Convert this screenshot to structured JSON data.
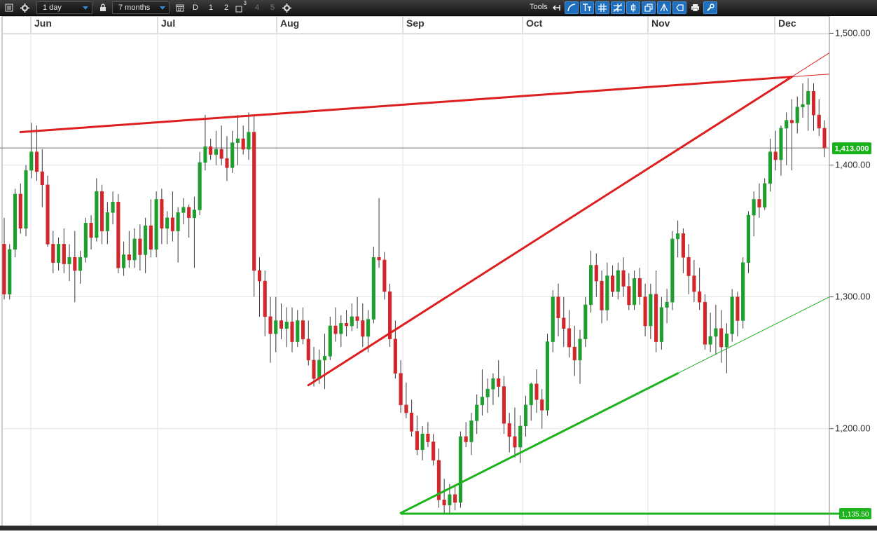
{
  "toolbar": {
    "interval": "1 day",
    "range": "7 months",
    "buttons": [
      "D",
      "1",
      "2",
      "4",
      "5"
    ],
    "layout_badge": "3",
    "tools_label": "Tools"
  },
  "chart_data": {
    "type": "candlestick",
    "x_labels": [
      "Jun",
      "Jul",
      "Aug",
      "Sep",
      "Oct",
      "Nov",
      "Dec"
    ],
    "y_ticks": [
      "1,500.00",
      "1,400.00",
      "1,300.00",
      "1,200.00"
    ],
    "ylim": [
      1120,
      1500
    ],
    "current_price": 1413.0,
    "current_price_label": "1,413.000",
    "horizontal_line": 1135.5,
    "horizontal_line_label": "1,135.50",
    "up_color": "#1e9e2e",
    "down_color": "#d3262a",
    "trendlines": [
      {
        "color": "#dd1f1f",
        "from": {
          "i": 3,
          "v": 1425
        },
        "to": {
          "i": 145,
          "v": 1467
        }
      },
      {
        "color": "#dd1f1f",
        "from": {
          "i": 56,
          "v": 1233
        },
        "to": {
          "i": 145,
          "v": 1467
        }
      },
      {
        "color": "#1db31d",
        "from": {
          "i": 73,
          "v": 1136
        },
        "to": {
          "i": 124,
          "v": 1242
        }
      }
    ],
    "candles": [
      [
        1340,
        1360,
        1298,
        1302
      ],
      [
        1302,
        1340,
        1298,
        1336
      ],
      [
        1336,
        1382,
        1330,
        1378
      ],
      [
        1378,
        1386,
        1348,
        1352
      ],
      [
        1352,
        1400,
        1346,
        1396
      ],
      [
        1396,
        1432,
        1390,
        1410
      ],
      [
        1410,
        1430,
        1388,
        1395
      ],
      [
        1395,
        1412,
        1368,
        1385
      ],
      [
        1385,
        1392,
        1338,
        1340
      ],
      [
        1340,
        1350,
        1318,
        1326
      ],
      [
        1326,
        1345,
        1320,
        1340
      ],
      [
        1340,
        1352,
        1318,
        1325
      ],
      [
        1325,
        1340,
        1312,
        1330
      ],
      [
        1330,
        1350,
        1296,
        1320
      ],
      [
        1320,
        1335,
        1310,
        1330
      ],
      [
        1330,
        1360,
        1326,
        1356
      ],
      [
        1356,
        1362,
        1336,
        1345
      ],
      [
        1345,
        1390,
        1342,
        1380
      ],
      [
        1380,
        1385,
        1340,
        1350
      ],
      [
        1350,
        1372,
        1340,
        1364
      ],
      [
        1364,
        1380,
        1355,
        1372
      ],
      [
        1372,
        1378,
        1318,
        1322
      ],
      [
        1322,
        1342,
        1316,
        1332
      ],
      [
        1332,
        1350,
        1322,
        1328
      ],
      [
        1328,
        1352,
        1322,
        1344
      ],
      [
        1344,
        1355,
        1320,
        1332
      ],
      [
        1332,
        1360,
        1318,
        1354
      ],
      [
        1354,
        1374,
        1330,
        1336
      ],
      [
        1336,
        1380,
        1330,
        1374
      ],
      [
        1374,
        1382,
        1340,
        1352
      ],
      [
        1352,
        1365,
        1340,
        1360
      ],
      [
        1360,
        1380,
        1342,
        1350
      ],
      [
        1350,
        1368,
        1326,
        1364
      ],
      [
        1364,
        1375,
        1355,
        1368
      ],
      [
        1368,
        1370,
        1345,
        1360
      ],
      [
        1360,
        1376,
        1322,
        1366
      ],
      [
        1366,
        1410,
        1362,
        1402
      ],
      [
        1402,
        1438,
        1396,
        1414
      ],
      [
        1414,
        1420,
        1404,
        1408
      ],
      [
        1408,
        1426,
        1400,
        1412
      ],
      [
        1412,
        1430,
        1400,
        1405
      ],
      [
        1405,
        1422,
        1388,
        1398
      ],
      [
        1398,
        1426,
        1394,
        1417
      ],
      [
        1417,
        1438,
        1400,
        1420
      ],
      [
        1420,
        1430,
        1408,
        1412
      ],
      [
        1412,
        1440,
        1404,
        1425
      ],
      [
        1425,
        1438,
        1300,
        1320
      ],
      [
        1320,
        1330,
        1285,
        1312
      ],
      [
        1312,
        1320,
        1270,
        1285
      ],
      [
        1285,
        1300,
        1250,
        1272
      ],
      [
        1272,
        1300,
        1258,
        1282
      ],
      [
        1282,
        1295,
        1268,
        1276
      ],
      [
        1276,
        1292,
        1262,
        1281
      ],
      [
        1281,
        1292,
        1258,
        1266
      ],
      [
        1266,
        1290,
        1262,
        1282
      ],
      [
        1282,
        1292,
        1264,
        1268
      ],
      [
        1268,
        1282,
        1248,
        1252
      ],
      [
        1252,
        1262,
        1232,
        1238
      ],
      [
        1238,
        1260,
        1234,
        1252
      ],
      [
        1252,
        1272,
        1230,
        1255
      ],
      [
        1255,
        1285,
        1252,
        1278
      ],
      [
        1278,
        1292,
        1266,
        1272
      ],
      [
        1272,
        1286,
        1262,
        1280
      ],
      [
        1280,
        1290,
        1270,
        1278
      ],
      [
        1278,
        1295,
        1274,
        1285
      ],
      [
        1285,
        1300,
        1276,
        1282
      ],
      [
        1282,
        1295,
        1262,
        1270
      ],
      [
        1270,
        1290,
        1258,
        1283
      ],
      [
        1283,
        1338,
        1280,
        1330
      ],
      [
        1330,
        1375,
        1322,
        1328
      ],
      [
        1328,
        1334,
        1298,
        1304
      ],
      [
        1304,
        1310,
        1262,
        1268
      ],
      [
        1268,
        1282,
        1238,
        1242
      ],
      [
        1242,
        1252,
        1212,
        1218
      ],
      [
        1218,
        1235,
        1208,
        1212
      ],
      [
        1212,
        1222,
        1194,
        1198
      ],
      [
        1198,
        1210,
        1180,
        1184
      ],
      [
        1184,
        1202,
        1176,
        1196
      ],
      [
        1196,
        1205,
        1186,
        1190
      ],
      [
        1190,
        1196,
        1172,
        1176
      ],
      [
        1176,
        1185,
        1140,
        1146
      ],
      [
        1146,
        1162,
        1136,
        1142
      ],
      [
        1142,
        1158,
        1136,
        1150
      ],
      [
        1150,
        1156,
        1138,
        1144
      ],
      [
        1144,
        1198,
        1140,
        1194
      ],
      [
        1194,
        1205,
        1186,
        1190
      ],
      [
        1190,
        1212,
        1180,
        1206
      ],
      [
        1206,
        1226,
        1196,
        1218
      ],
      [
        1218,
        1245,
        1210,
        1224
      ],
      [
        1224,
        1238,
        1212,
        1230
      ],
      [
        1230,
        1242,
        1218,
        1238
      ],
      [
        1238,
        1252,
        1224,
        1232
      ],
      [
        1232,
        1240,
        1196,
        1204
      ],
      [
        1204,
        1212,
        1182,
        1194
      ],
      [
        1194,
        1216,
        1178,
        1186
      ],
      [
        1186,
        1210,
        1174,
        1202
      ],
      [
        1202,
        1225,
        1194,
        1218
      ],
      [
        1218,
        1235,
        1206,
        1234
      ],
      [
        1234,
        1245,
        1212,
        1222
      ],
      [
        1222,
        1230,
        1200,
        1214
      ],
      [
        1214,
        1272,
        1210,
        1266
      ],
      [
        1266,
        1305,
        1258,
        1300
      ],
      [
        1300,
        1310,
        1270,
        1284
      ],
      [
        1284,
        1300,
        1262,
        1276
      ],
      [
        1276,
        1290,
        1254,
        1262
      ],
      [
        1262,
        1278,
        1240,
        1252
      ],
      [
        1252,
        1275,
        1234,
        1268
      ],
      [
        1268,
        1300,
        1262,
        1294
      ],
      [
        1294,
        1335,
        1288,
        1324
      ],
      [
        1324,
        1333,
        1300,
        1312
      ],
      [
        1312,
        1320,
        1280,
        1290
      ],
      [
        1290,
        1326,
        1282,
        1316
      ],
      [
        1316,
        1324,
        1300,
        1304
      ],
      [
        1304,
        1326,
        1298,
        1320
      ],
      [
        1320,
        1330,
        1300,
        1308
      ],
      [
        1308,
        1318,
        1290,
        1294
      ],
      [
        1294,
        1320,
        1290,
        1314
      ],
      [
        1314,
        1322,
        1294,
        1300
      ],
      [
        1300,
        1310,
        1270,
        1278
      ],
      [
        1278,
        1310,
        1268,
        1302
      ],
      [
        1302,
        1320,
        1258,
        1266
      ],
      [
        1266,
        1300,
        1260,
        1292
      ],
      [
        1292,
        1306,
        1280,
        1296
      ],
      [
        1296,
        1350,
        1290,
        1344
      ],
      [
        1344,
        1358,
        1330,
        1348
      ],
      [
        1348,
        1352,
        1318,
        1330
      ],
      [
        1330,
        1340,
        1302,
        1316
      ],
      [
        1316,
        1328,
        1296,
        1304
      ],
      [
        1304,
        1322,
        1290,
        1296
      ],
      [
        1296,
        1302,
        1260,
        1264
      ],
      [
        1264,
        1288,
        1258,
        1270
      ],
      [
        1270,
        1294,
        1256,
        1276
      ],
      [
        1276,
        1290,
        1250,
        1262
      ],
      [
        1262,
        1280,
        1242,
        1272
      ],
      [
        1272,
        1306,
        1266,
        1300
      ],
      [
        1300,
        1304,
        1270,
        1282
      ]
    ],
    "candles_tail": [
      [
        1282,
        1330,
        1276,
        1326
      ],
      [
        1326,
        1365,
        1318,
        1362
      ],
      [
        1362,
        1380,
        1346,
        1374
      ],
      [
        1374,
        1386,
        1360,
        1368
      ],
      [
        1368,
        1390,
        1366,
        1386
      ],
      [
        1386,
        1420,
        1380,
        1410
      ],
      [
        1410,
        1426,
        1396,
        1404
      ],
      [
        1404,
        1430,
        1392,
        1428
      ],
      [
        1428,
        1440,
        1400,
        1434
      ],
      [
        1434,
        1450,
        1396,
        1432
      ],
      [
        1432,
        1452,
        1424,
        1444
      ],
      [
        1444,
        1462,
        1436,
        1446
      ],
      [
        1446,
        1466,
        1426,
        1456
      ],
      [
        1456,
        1462,
        1426,
        1438
      ],
      [
        1438,
        1450,
        1422,
        1428
      ],
      [
        1428,
        1434,
        1406,
        1413
      ]
    ]
  }
}
